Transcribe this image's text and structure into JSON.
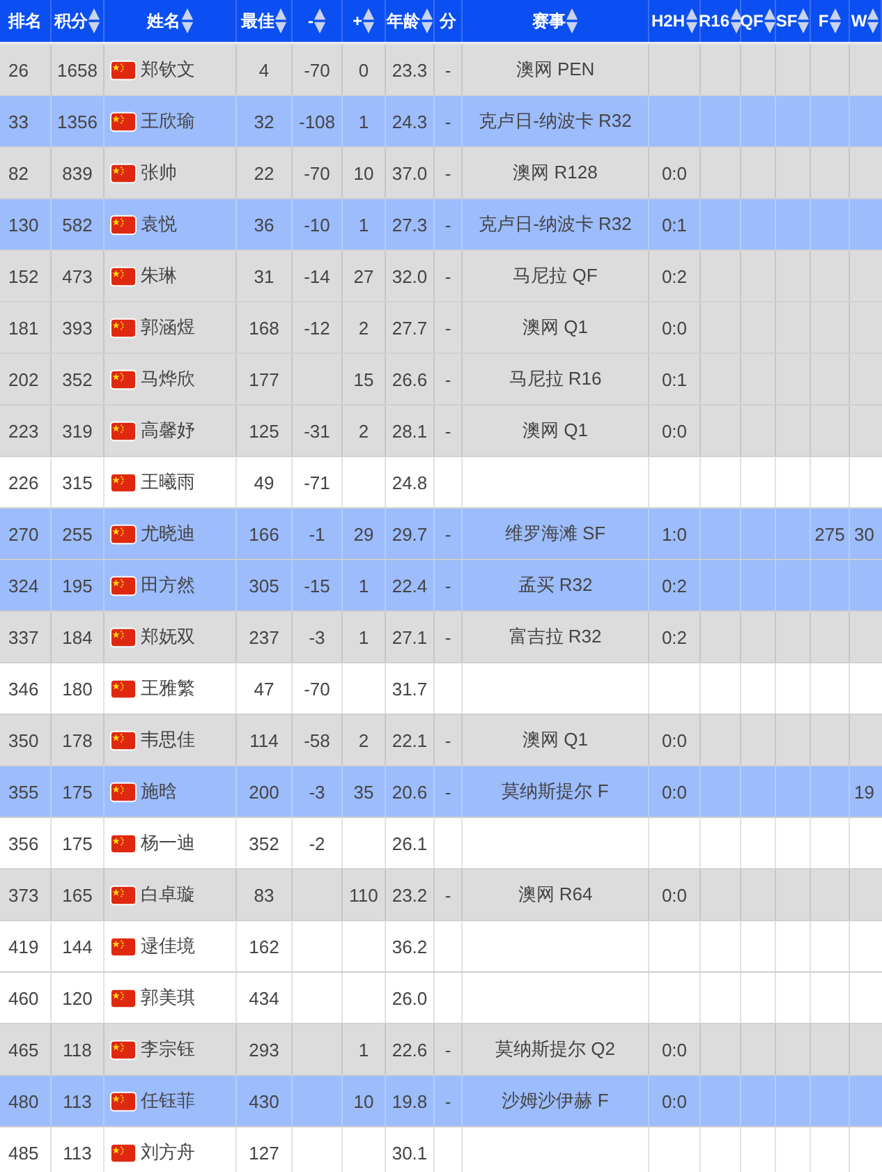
{
  "table": {
    "columns": [
      {
        "label": "排名",
        "sortable": false
      },
      {
        "label": "积分",
        "sortable": true
      },
      {
        "label": "姓名",
        "sortable": true
      },
      {
        "label": "最佳",
        "sortable": true
      },
      {
        "label": "-",
        "sortable": true
      },
      {
        "label": "+",
        "sortable": true
      },
      {
        "label": "年龄",
        "sortable": true
      },
      {
        "label": "分",
        "sortable": false
      },
      {
        "label": "赛事",
        "sortable": true
      },
      {
        "label": "H2H",
        "sortable": true
      },
      {
        "label": "R16",
        "sortable": true
      },
      {
        "label": "QF",
        "sortable": true
      },
      {
        "label": "SF",
        "sortable": true
      },
      {
        "label": "F",
        "sortable": true
      },
      {
        "label": "W",
        "sortable": true
      }
    ],
    "rows": [
      {
        "kind": "entered",
        "cells": [
          "26",
          "1658",
          "郑钦文",
          "4",
          "-70",
          "0",
          "23.3",
          "-",
          "澳网 PEN",
          null,
          null,
          null,
          null,
          null,
          null
        ]
      },
      {
        "kind": "live",
        "cells": [
          "33",
          "1356",
          "王欣瑜",
          "32",
          "-108",
          "1",
          "24.3",
          "-",
          "克卢日-纳波卡 R32",
          null,
          null,
          null,
          null,
          null,
          null
        ]
      },
      {
        "kind": "entered",
        "cells": [
          "82",
          "839",
          "张帅",
          "22",
          "-70",
          "10",
          "37.0",
          "-",
          "澳网 R128",
          "0:0",
          null,
          null,
          null,
          null,
          null
        ]
      },
      {
        "kind": "live",
        "cells": [
          "130",
          "582",
          "袁悦",
          "36",
          "-10",
          "1",
          "27.3",
          "-",
          "克卢日-纳波卡 R32",
          "0:1",
          null,
          null,
          null,
          null,
          null
        ]
      },
      {
        "kind": "entered",
        "cells": [
          "152",
          "473",
          "朱琳",
          "31",
          "-14",
          "27",
          "32.0",
          "-",
          "马尼拉 QF",
          "0:2",
          null,
          null,
          null,
          null,
          null
        ]
      },
      {
        "kind": "entered",
        "cells": [
          "181",
          "393",
          "郭涵煜",
          "168",
          "-12",
          "2",
          "27.7",
          "-",
          "澳网 Q1",
          "0:0",
          null,
          null,
          null,
          null,
          null
        ]
      },
      {
        "kind": "entered",
        "cells": [
          "202",
          "352",
          "马烨欣",
          "177",
          null,
          "15",
          "26.6",
          "-",
          "马尼拉 R16",
          "0:1",
          null,
          null,
          null,
          null,
          null
        ]
      },
      {
        "kind": "entered",
        "cells": [
          "223",
          "319",
          "高馨妤",
          "125",
          "-31",
          "2",
          "28.1",
          "-",
          "澳网 Q1",
          "0:0",
          null,
          null,
          null,
          null,
          null
        ]
      },
      {
        "kind": "idle",
        "cells": [
          "226",
          "315",
          "王曦雨",
          "49",
          "-71",
          null,
          "24.8",
          null,
          null,
          null,
          null,
          null,
          null,
          null,
          null
        ]
      },
      {
        "kind": "live",
        "cells": [
          "270",
          "255",
          "尤晓迪",
          "166",
          "-1",
          "29",
          "29.7",
          "-",
          "维罗海滩 SF",
          "1:0",
          null,
          null,
          null,
          "275",
          "30"
        ]
      },
      {
        "kind": "live",
        "cells": [
          "324",
          "195",
          "田方然",
          "305",
          "-15",
          "1",
          "22.4",
          "-",
          "孟买 R32",
          "0:2",
          null,
          null,
          null,
          null,
          null
        ]
      },
      {
        "kind": "entered",
        "cells": [
          "337",
          "184",
          "郑妩双",
          "237",
          "-3",
          "1",
          "27.1",
          "-",
          "富吉拉 R32",
          "0:2",
          null,
          null,
          null,
          null,
          null
        ]
      },
      {
        "kind": "idle",
        "cells": [
          "346",
          "180",
          "王雅繁",
          "47",
          "-70",
          null,
          "31.7",
          null,
          null,
          null,
          null,
          null,
          null,
          null,
          null
        ]
      },
      {
        "kind": "entered",
        "cells": [
          "350",
          "178",
          "韦思佳",
          "114",
          "-58",
          "2",
          "22.1",
          "-",
          "澳网 Q1",
          "0:0",
          null,
          null,
          null,
          null,
          null
        ]
      },
      {
        "kind": "live",
        "cells": [
          "355",
          "175",
          "施晗",
          "200",
          "-3",
          "35",
          "20.6",
          "-",
          "莫纳斯提尔 F",
          "0:0",
          null,
          null,
          null,
          null,
          "19"
        ]
      },
      {
        "kind": "idle",
        "cells": [
          "356",
          "175",
          "杨一迪",
          "352",
          "-2",
          null,
          "26.1",
          null,
          null,
          null,
          null,
          null,
          null,
          null,
          null
        ]
      },
      {
        "kind": "entered",
        "cells": [
          "373",
          "165",
          "白卓璇",
          "83",
          null,
          "110",
          "23.2",
          "-",
          "澳网 R64",
          "0:0",
          null,
          null,
          null,
          null,
          null
        ]
      },
      {
        "kind": "idle",
        "cells": [
          "419",
          "144",
          "逯佳境",
          "162",
          null,
          null,
          "36.2",
          null,
          null,
          null,
          null,
          null,
          null,
          null,
          null
        ]
      },
      {
        "kind": "idle",
        "cells": [
          "460",
          "120",
          "郭美琪",
          "434",
          null,
          null,
          "26.0",
          null,
          null,
          null,
          null,
          null,
          null,
          null,
          null
        ]
      },
      {
        "kind": "entered",
        "cells": [
          "465",
          "118",
          "李宗钰",
          "293",
          null,
          "1",
          "22.6",
          "-",
          "莫纳斯提尔 Q2",
          "0:0",
          null,
          null,
          null,
          null,
          null
        ]
      },
      {
        "kind": "live",
        "cells": [
          "480",
          "113",
          "任钰菲",
          "430",
          null,
          "10",
          "19.8",
          "-",
          "沙姆沙伊赫 F",
          "0:0",
          null,
          null,
          null,
          null,
          null
        ]
      },
      {
        "kind": "idle",
        "cells": [
          "485",
          "113",
          "刘方舟",
          "127",
          null,
          null,
          "30.1",
          null,
          null,
          null,
          null,
          null,
          null,
          null,
          null
        ]
      }
    ]
  }
}
